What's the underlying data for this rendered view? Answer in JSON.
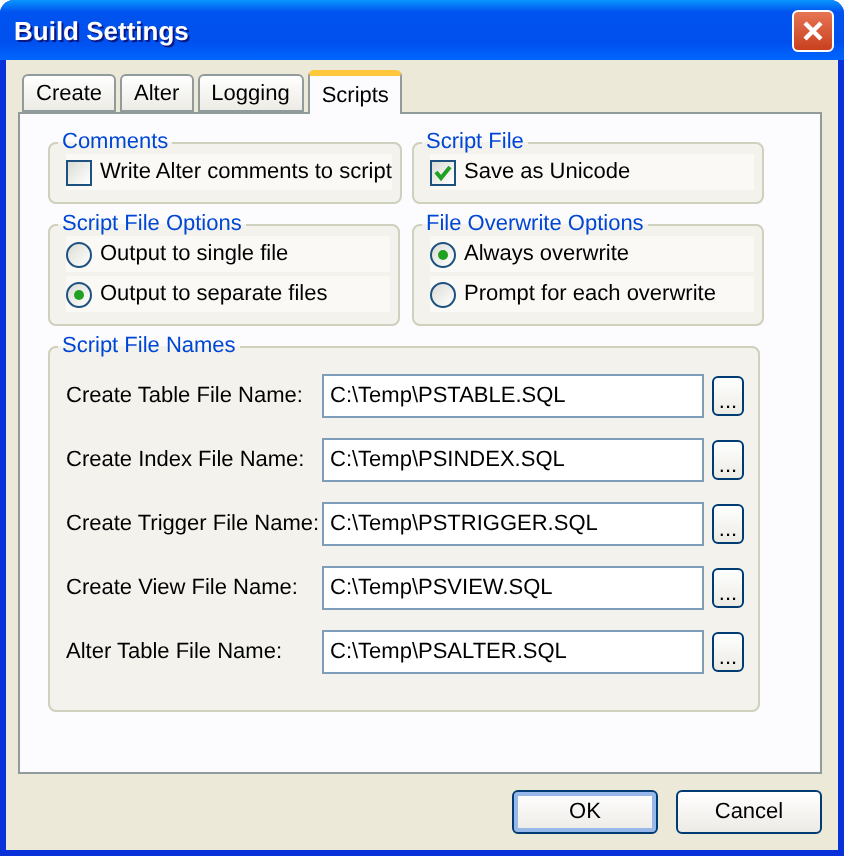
{
  "window": {
    "title": "Build Settings"
  },
  "tabs": [
    {
      "label": "Create",
      "selected": false
    },
    {
      "label": "Alter",
      "selected": false
    },
    {
      "label": "Logging",
      "selected": false
    },
    {
      "label": "Scripts",
      "selected": true
    }
  ],
  "option_groups": [
    {
      "title": "Comments",
      "kind": "checkbox",
      "items": [
        {
          "label": "Write Alter comments to script",
          "checked": false
        }
      ]
    },
    {
      "title": "Script File",
      "kind": "checkbox",
      "items": [
        {
          "label": "Save as Unicode",
          "checked": true
        }
      ]
    },
    {
      "title": "Script File Options",
      "kind": "radio",
      "items": [
        {
          "label": "Output to single file",
          "selected": false
        },
        {
          "label": "Output to separate files",
          "selected": true
        }
      ]
    },
    {
      "title": "File Overwrite Options",
      "kind": "radio",
      "items": [
        {
          "label": "Always overwrite",
          "selected": true
        },
        {
          "label": "Prompt for each overwrite",
          "selected": false
        }
      ]
    }
  ],
  "script_file_names": {
    "title": "Script File Names",
    "rows": [
      {
        "label": "Create Table File Name:",
        "value": "C:\\Temp\\PSTABLE.SQL",
        "button": "..."
      },
      {
        "label": "Create Index File Name:",
        "value": "C:\\Temp\\PSINDEX.SQL",
        "button": "..."
      },
      {
        "label": "Create Trigger File Name:",
        "value": "C:\\Temp\\PSTRIGGER.SQL",
        "button": "..."
      },
      {
        "label": "Create View File Name:",
        "value": "C:\\Temp\\PSVIEW.SQL",
        "button": "..."
      },
      {
        "label": "Alter Table File Name:",
        "value": "C:\\Temp\\PSALTER.SQL",
        "button": "..."
      }
    ]
  },
  "buttons": [
    {
      "label": "OK",
      "kind": "default"
    },
    {
      "label": "Cancel",
      "kind": "normal"
    }
  ]
}
